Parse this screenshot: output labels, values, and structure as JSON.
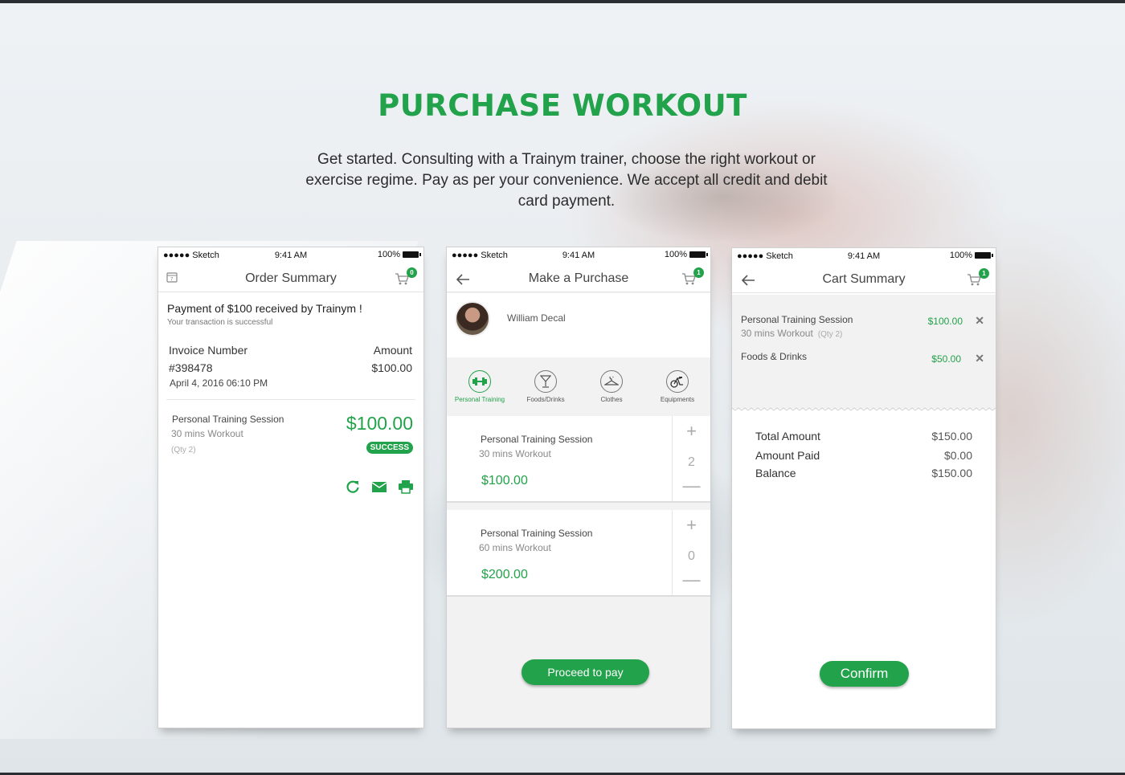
{
  "hero": {
    "title": "PURCHASE WORKOUT",
    "subtitle": "Get started. Consulting with a Trainym trainer, choose the right workout or exercise regime. Pay as per your convenience. We accept all credit and debit card payment."
  },
  "status_bar": {
    "carrier": "●●●●● Sketch",
    "time": "9:41 AM",
    "battery": "100%"
  },
  "colors": {
    "accent": "#22a24a"
  },
  "order_summary": {
    "title": "Order Summary",
    "cart_count": "0",
    "payment_message": "Payment of $100 received by Trainym !",
    "payment_sub": "Your transaction is successful",
    "invoice_label": "Invoice Number",
    "invoice_number": "#398478",
    "invoice_date": "April 4, 2016  06:10 PM",
    "amount_label": "Amount",
    "amount_value": "$100.00",
    "item_name": "Personal Training Session",
    "item_sub": "30 mins Workout",
    "item_qty": "(Qty 2)",
    "item_price": "$100.00",
    "status_badge": "SUCCESS",
    "icons": [
      "calendar-icon",
      "refresh-icon",
      "email-icon",
      "print-icon"
    ]
  },
  "make_purchase": {
    "title": "Make a Purchase",
    "cart_count": "1",
    "trainer_name": "William Decal",
    "categories": [
      {
        "label": "Personal Training",
        "icon": "dumbbell-icon"
      },
      {
        "label": "Foods/Drinks",
        "icon": "cocktail-icon"
      },
      {
        "label": "Clothes",
        "icon": "hanger-icon"
      },
      {
        "label": "Equipments",
        "icon": "exercise-bike-icon"
      }
    ],
    "items": [
      {
        "name": "Personal Training Session",
        "sub": "30 mins Workout",
        "price": "$100.00",
        "qty": "2"
      },
      {
        "name": "Personal Training Session",
        "sub": "60 mins Workout",
        "price": "$200.00",
        "qty": "0"
      }
    ],
    "proceed_label": "Proceed to pay"
  },
  "cart_summary": {
    "title": "Cart Summary",
    "cart_count": "1",
    "items": [
      {
        "name": "Personal Training Session",
        "sub": "30 mins Workout",
        "qty": "(Qty 2)",
        "price": "$100.00"
      },
      {
        "name": "Foods & Drinks",
        "sub": "",
        "qty": "",
        "price": "$50.00"
      }
    ],
    "total_label": "Total Amount",
    "total_value": "$150.00",
    "paid_label": "Amount Paid",
    "paid_value": "$0.00",
    "balance_label": "Balance",
    "balance_value": "$150.00",
    "confirm_label": "Confirm"
  }
}
